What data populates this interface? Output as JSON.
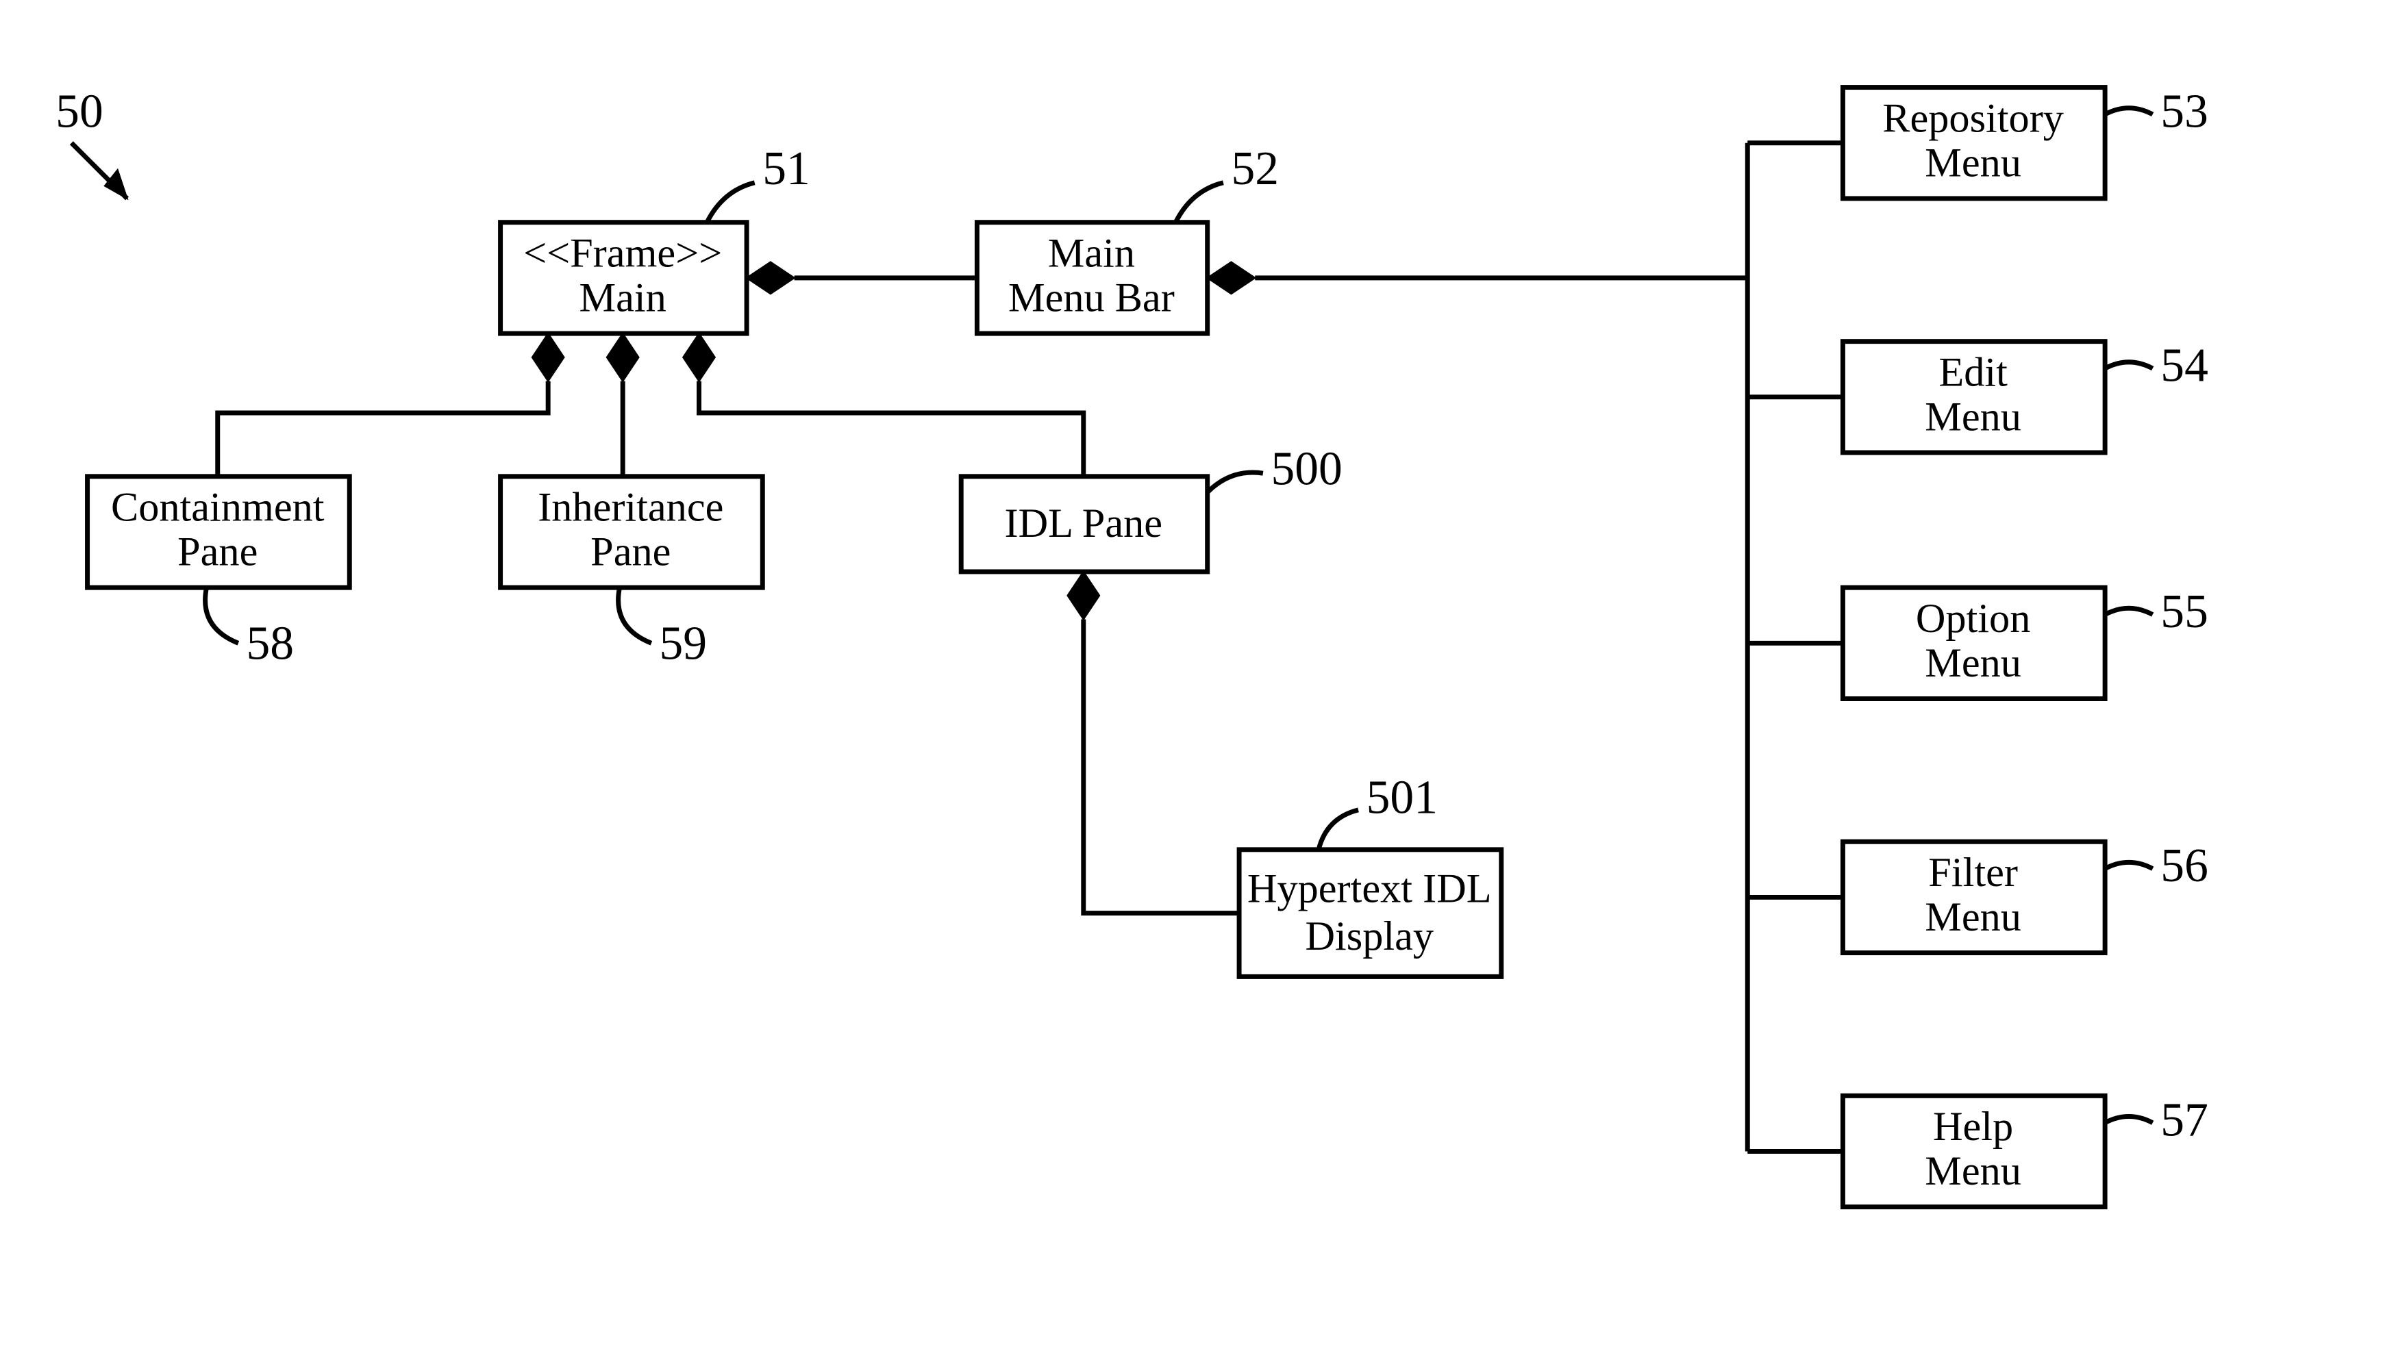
{
  "diagram_ref": "50",
  "nodes": {
    "main": {
      "ref": "51",
      "line1": "<<Frame>>",
      "line2": "Main"
    },
    "menubar": {
      "ref": "52",
      "line1": "Main",
      "line2": "Menu Bar"
    },
    "repo": {
      "ref": "53",
      "line1": "Repository",
      "line2": "Menu"
    },
    "edit": {
      "ref": "54",
      "line1": "Edit",
      "line2": "Menu"
    },
    "option": {
      "ref": "55",
      "line1": "Option",
      "line2": "Menu"
    },
    "filter": {
      "ref": "56",
      "line1": "Filter",
      "line2": "Menu"
    },
    "help": {
      "ref": "57",
      "line1": "Help",
      "line2": "Menu"
    },
    "containment": {
      "ref": "58",
      "line1": "Containment",
      "line2": "Pane"
    },
    "inheritance": {
      "ref": "59",
      "line1": "Inheritance",
      "line2": "Pane"
    },
    "idl": {
      "ref": "500",
      "line1": "IDL Pane",
      "line2": ""
    },
    "hypertext": {
      "ref": "501",
      "line1": "Hypertext IDL",
      "line2": "Display"
    }
  }
}
